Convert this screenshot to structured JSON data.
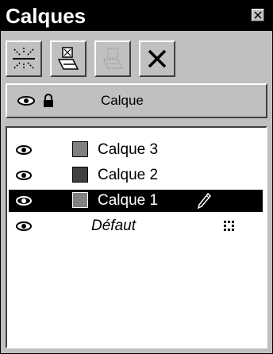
{
  "panel": {
    "title": "Calques"
  },
  "toolbar": {
    "buttons": [
      {
        "icon": "new-layer-icon",
        "label": ""
      },
      {
        "icon": "merge-layer-icon",
        "label": ""
      },
      {
        "icon": "layer-disabled-icon",
        "label": ""
      },
      {
        "icon": "delete-x-icon",
        "label": ""
      }
    ]
  },
  "header": {
    "column_label": "Calque"
  },
  "layers": [
    {
      "name": "Calque 3",
      "visible": true,
      "color": "#808080",
      "selected": false
    },
    {
      "name": "Calque 2",
      "visible": true,
      "color": "#404040",
      "selected": false
    },
    {
      "name": "Calque 1",
      "visible": true,
      "color": "#808080",
      "selected": true
    },
    {
      "name": "Défaut",
      "visible": true,
      "color": null,
      "selected": false
    }
  ],
  "colors": {
    "title_bg": "#000000",
    "panel_bg": "#c0c0c0",
    "selection_bg": "#000000"
  }
}
